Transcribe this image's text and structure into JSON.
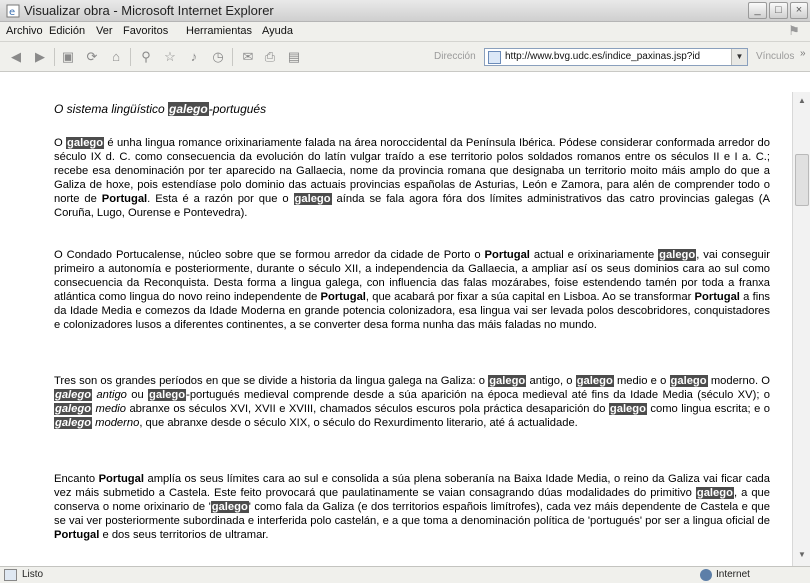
{
  "window": {
    "title": "Visualizar obra - Microsoft Internet Explorer"
  },
  "menu": [
    "Archivo",
    "Edición",
    "Ver",
    "Favoritos",
    "Herramientas",
    "Ayuda"
  ],
  "toolbar": {
    "icons": [
      "back-icon",
      "forward-icon",
      "stop-icon",
      "refresh-icon",
      "home-icon",
      "search-icon",
      "favorites-icon",
      "media-icon",
      "history-icon",
      "mail-icon",
      "print-icon",
      "edit-icon"
    ],
    "address_label": "Dirección",
    "address_url": "http://www.bvg.udc.es/indice_paxinas.jsp?id",
    "links_label": "Vínculos"
  },
  "content": {
    "heading": [
      {
        "t": "O sistema lingüístico "
      },
      {
        "t": "galego",
        "hl": true
      },
      {
        "t": "-portugués"
      }
    ],
    "paragraphs": [
      [
        {
          "t": "O "
        },
        {
          "t": "galego",
          "hl": true
        },
        {
          "t": " é unha lingua romance orixinariamente falada na área noroccidental da Península Ibérica. Pódese considerar conformada arredor do século IX d. C. como consecuencia da evolución do latín vulgar traído a ese territorio polos soldados romanos entre os séculos II e I a. C.; recebe esa denominación por ter aparecido na Gallaecia, nome da provincia romana que designaba un territorio moito máis amplo do que a Galiza de hoxe, pois estendíase polo dominio das actuais provincias españolas de Asturias, León e Zamora, para alén de comprender todo o norte de "
        },
        {
          "t": "Portugal",
          "b": true
        },
        {
          "t": ". Esta é a razón por que o "
        },
        {
          "t": "galego",
          "hl": true
        },
        {
          "t": " aínda se fala agora fóra dos límites administrativos das catro provincias galegas (A Coruña, Lugo, Ourense e Pontevedra)."
        }
      ],
      [
        {
          "t": "O Condado Portucalense, núcleo sobre que se formou arredor da cidade de Porto o "
        },
        {
          "t": "Portugal",
          "b": true
        },
        {
          "t": " actual e orixinariamente "
        },
        {
          "t": "galego",
          "hl": true
        },
        {
          "t": ", vai conseguir primeiro a autonomía e posteriormente, durante o século XII, a independencia da Gallaecia, a ampliar así os seus dominios cara ao sul como consecuencia da Reconquista. Desta forma a lingua galega, con influencia das falas mozárabes, foise estendendo tamén por toda a franxa atlántica como lingua do novo reino independente de "
        },
        {
          "t": "Portugal",
          "b": true
        },
        {
          "t": ", que acabará por fixar a súa capital en Lisboa. Ao se transformar "
        },
        {
          "t": "Portugal",
          "b": true
        },
        {
          "t": " a fins da Idade Media e comezos da Idade Moderna en grande potencia colonizadora, esa lingua vai ser levada polos descobridores, conquistadores e colonizadores lusos a diferentes continentes, a se converter desa forma nunha das máis faladas no mundo."
        }
      ],
      [
        {
          "t": "Tres son os grandes períodos en que se divide a historia da lingua galega na Galiza: o "
        },
        {
          "t": "galego",
          "hl": true
        },
        {
          "t": " antigo, o "
        },
        {
          "t": "galego",
          "hl": true
        },
        {
          "t": " medio e o "
        },
        {
          "t": "galego",
          "hl": true
        },
        {
          "t": " moderno. O "
        },
        {
          "t": "galego",
          "hl": true,
          "i": true
        },
        {
          "t": " antigo",
          "i": true
        },
        {
          "t": " ou "
        },
        {
          "t": "galego",
          "hl": true
        },
        {
          "t": "-portugués medieval comprende desde a súa aparición na época medieval até fins da Idade Media (século XV); o "
        },
        {
          "t": "galego",
          "hl": true,
          "i": true
        },
        {
          "t": " medio",
          "i": true
        },
        {
          "t": " abranxe os séculos XVI, XVII e XVIII, chamados séculos escuros pola práctica desaparición do "
        },
        {
          "t": "galego",
          "hl": true
        },
        {
          "t": " como lingua escrita; e o "
        },
        {
          "t": "galego",
          "hl": true,
          "i": true
        },
        {
          "t": " moderno",
          "i": true
        },
        {
          "t": ", que abranxe desde o século XIX, o século do Rexurdimento literario, até á actualidade."
        }
      ],
      [
        {
          "t": "Encanto "
        },
        {
          "t": "Portugal",
          "b": true
        },
        {
          "t": " amplía os seus límites cara ao sul e consolida a súa plena soberanía na Baixa Idade Media, o reino da Galiza vai ficar cada vez máis submetido a Castela. Este feito provocará que paulatinamente se vaian consagrando dúas modalidades do primitivo "
        },
        {
          "t": "galego",
          "hl": true
        },
        {
          "t": ", a que conserva o nome orixinario de '"
        },
        {
          "t": "galego",
          "hl": true
        },
        {
          "t": "' como fala da Galiza (e dos territorios españois limítrofes), cada vez máis dependente de Castela e que se vai ver posteriormente subordinada e interferida polo castelán, e a que toma a denominación política de 'portugués' por ser a lingua oficial de "
        },
        {
          "t": "Portugal",
          "b": true
        },
        {
          "t": " e dos seus territorios de ultramar."
        }
      ]
    ]
  },
  "status": {
    "text": "Listo",
    "zone": "Internet"
  },
  "colors": {
    "highlight_bg": "#4d4d4d",
    "highlight_fg": "#ffffff"
  }
}
